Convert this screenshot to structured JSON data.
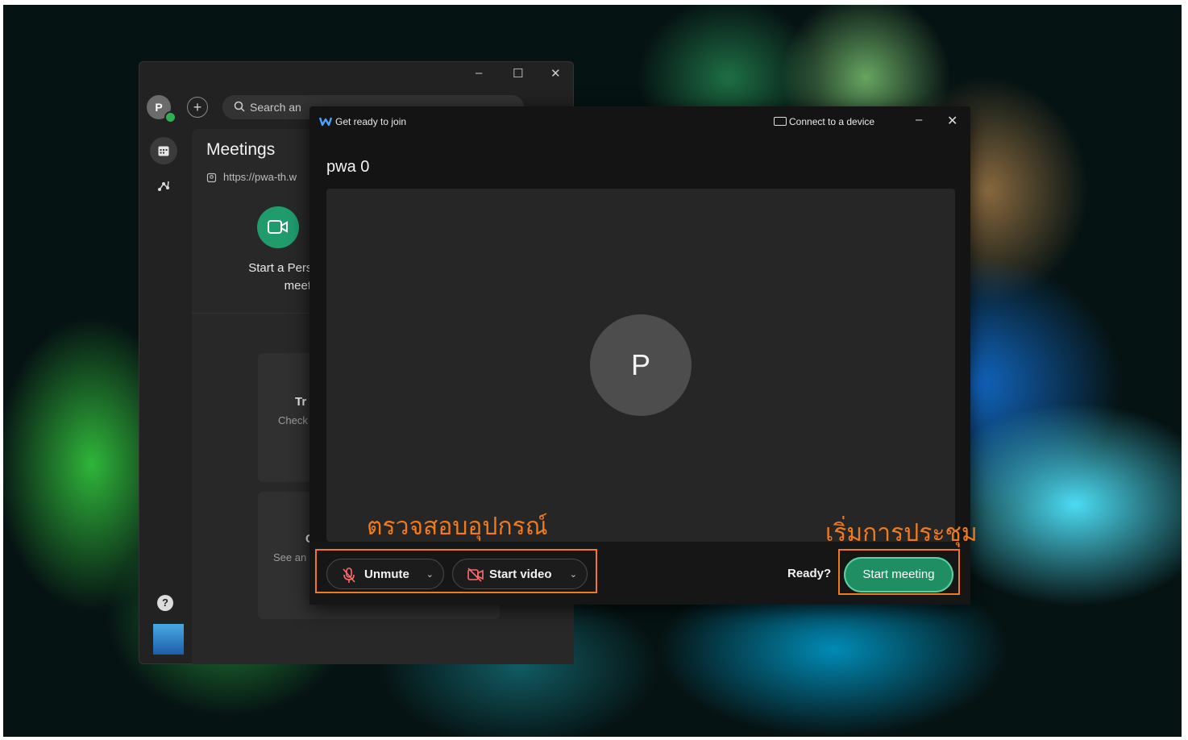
{
  "main_window": {
    "avatar_initial": "P",
    "add_symbol": "+",
    "search_placeholder": "Search an",
    "min_symbol": "–",
    "max_symbol": "☐",
    "close_symbol": "✕",
    "meetings_title": "Meetings",
    "meeting_link": "https://pwa-th.w",
    "start_personal_line1": "Start a Perso",
    "start_personal_line2": "meeti",
    "card1_title": "Tr",
    "card1_sub": "Check",
    "card2_title": "C",
    "card2_sub": "See an",
    "help_symbol": "?"
  },
  "dialog": {
    "title": "Get ready to join",
    "connect_device": "Connect to a device",
    "minimize_symbol": "–",
    "close_symbol": "✕",
    "meeting_name": "pwa 0",
    "avatar_initial": "P",
    "unmute_label": "Unmute",
    "start_video_label": "Start video",
    "dropdown_symbol": "⌄",
    "ready_label": "Ready?",
    "start_meeting_label": "Start meeting"
  },
  "annotations": {
    "devices_label": "ตรวจสอบอุปกรณ์",
    "start_label": "เริ่มการประชุม",
    "color": "#f07a1c"
  },
  "colors": {
    "accent_green": "#1f8f63",
    "presence_green": "#2fb153"
  }
}
